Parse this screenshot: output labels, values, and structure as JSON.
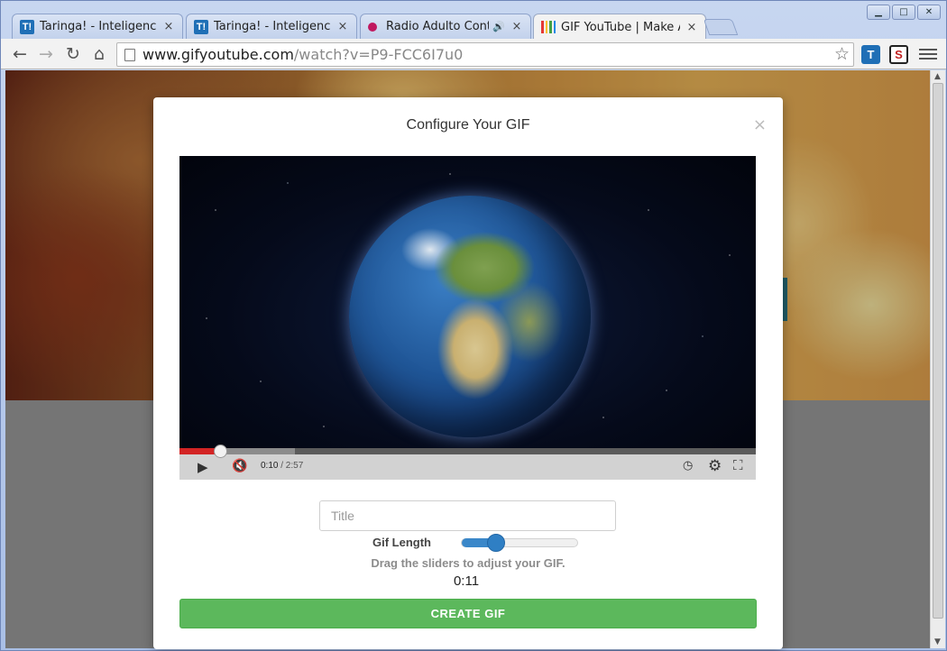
{
  "browser": {
    "tabs": [
      {
        "title": "Taringa! - Inteligencia",
        "favicon": "taringa-icon",
        "active": false
      },
      {
        "title": "Taringa! - Inteligencia",
        "favicon": "taringa-icon",
        "active": false
      },
      {
        "title": "Radio Adulto Conte",
        "favicon": "radio-dot-icon",
        "active": false,
        "audio": true
      },
      {
        "title": "GIF YouTube | Make Ar",
        "favicon": "gifyoutube-bars-icon",
        "active": true
      }
    ],
    "tab_close_glyph": "×",
    "url_host": "www.gifyoutube.com",
    "url_path": "/watch?v=P9-FCC6I7u0",
    "extension_t": "T",
    "extension_s": "S"
  },
  "modal": {
    "title": "Configure Your GIF",
    "close_glyph": "×",
    "video": {
      "current_time": "0:10",
      "total_time": "/ 2:57",
      "progress_played": 0.07,
      "progress_buffered": 0.2
    },
    "title_input": {
      "placeholder": "Title",
      "value": ""
    },
    "gif_length_label": "Gif Length",
    "gif_length_slider": 0.28,
    "hint": "Drag the sliders to adjust your GIF.",
    "duration": "0:11",
    "create_button": "CREATE GIF"
  },
  "colors": {
    "accent_green": "#5cb85c",
    "slider_blue": "#2f7fc4",
    "progress_red": "#d32424"
  }
}
